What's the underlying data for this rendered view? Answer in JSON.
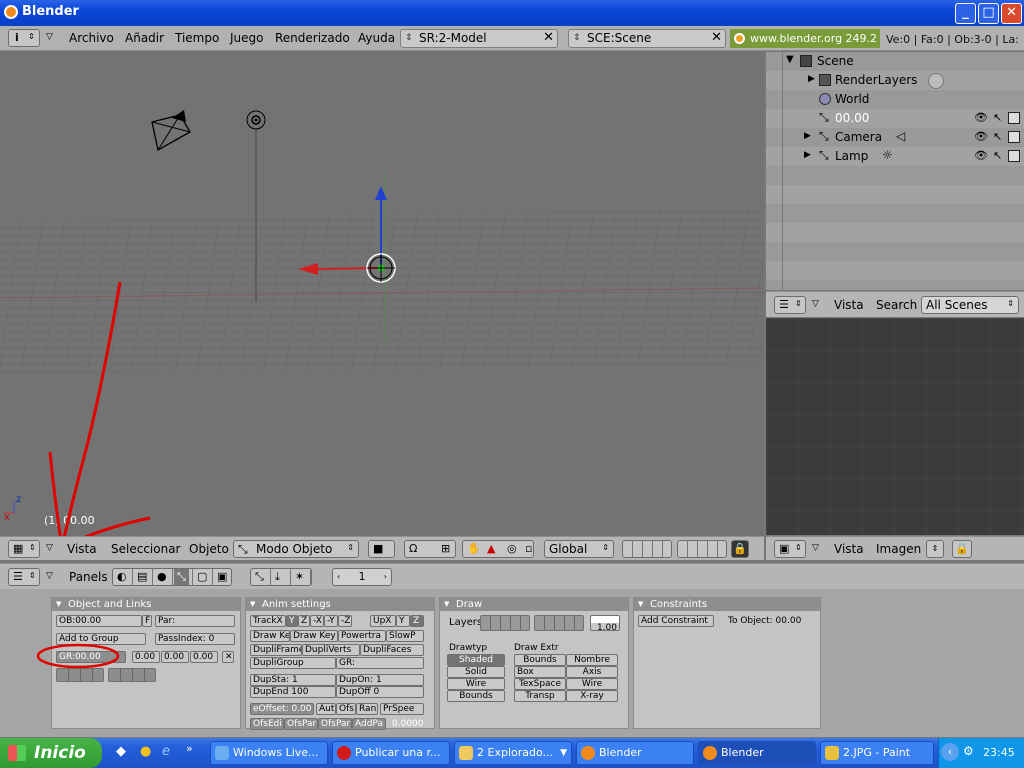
{
  "window": {
    "title": "Blender",
    "minimize": "_",
    "maximize": "□",
    "close": "✕"
  },
  "menubar": {
    "menus": [
      "Archivo",
      "Añadir",
      "Tiempo",
      "Juego",
      "Renderizado",
      "Ayuda"
    ],
    "screen": "SR:2-Model",
    "scene": "SCE:Scene",
    "url": "www.blender.org 249.2",
    "stats": "Ve:0 | Fa:0 | Ob:3-0 | La:"
  },
  "viewport": {
    "frame_label": "(1) 00.00",
    "axis_x": "x",
    "axis_z": "z"
  },
  "view3d_header": {
    "menus": [
      "Vista",
      "Seleccionar",
      "Objeto"
    ],
    "mode": "Modo Objeto",
    "orientation": "Global"
  },
  "outliner": {
    "items": [
      {
        "label": "Scene"
      },
      {
        "label": "RenderLayers"
      },
      {
        "label": "World"
      },
      {
        "label": "00.00"
      },
      {
        "label": "Camera"
      },
      {
        "label": "Lamp"
      }
    ],
    "header": {
      "menu1": "Vista",
      "menu2": "Search",
      "scenes": "All Scenes"
    }
  },
  "image_header": {
    "menu1": "Vista",
    "menu2": "Imagen"
  },
  "buttons_header": {
    "panels": "Panels",
    "frame": "1"
  },
  "panels": {
    "object_links": {
      "title": "Object and Links",
      "ob": "OB:00.00",
      "f": "F",
      "par": "Par:",
      "add_group": "Add to Group",
      "pass_index": "PassIndex: 0",
      "gr": "GR:00.00",
      "v1": "0.00",
      "v2": "0.00",
      "v3": "0.00",
      "x": "✕"
    },
    "anim": {
      "title": "Anim settings",
      "track": "TrackX",
      "y": "Y",
      "z": "Z",
      "mx": "-X",
      "my": "-Y",
      "mz": "-Z",
      "upx": "UpX",
      "upy": "Y",
      "upz": "Z",
      "drawkey": "Draw Ke",
      "drawkey2": "Draw Key",
      "powertrack": "Powertra",
      "slowpar": "SlowP",
      "dupliframes": "DupliFrame",
      "dupliverts": "DupliVerts",
      "duplifaces": "DupliFaces",
      "dupligroup": "DupliGroup",
      "gr": "GR:",
      "dupsta": "DupSta: 1",
      "dupon": "DupOn: 1",
      "dupend": "DupEnd 100",
      "dupoff": "DupOff 0",
      "offset": "eOffset: 0.00",
      "aut": "Aut",
      "ofs": "Ofs",
      "ran": "Ran",
      "prspeed": "PrSpee",
      "ofsedit": "OfsEdi",
      "ofspar": "OfsPar",
      "ofspar2": "OfsPar",
      "addpar": "AddPa",
      "zeros": "0.0000"
    },
    "draw": {
      "title": "Draw",
      "layers": "Layers",
      "scale": "1.00",
      "drawtype": "Drawtyp",
      "drawextra": "Draw Extr",
      "types": [
        "Shaded",
        "Solid",
        "Wire",
        "Bounds"
      ],
      "bounds": "Bounds",
      "nombre": "Nombre",
      "box": "Box",
      "axis": "Axis",
      "texspace": "TexSpace",
      "wire": "Wire",
      "transp": "Transp",
      "xray": "X-ray"
    },
    "constraints": {
      "title": "Constraints",
      "add": "Add Constraint",
      "to": "To Object: 00.00"
    }
  },
  "taskbar": {
    "start": "Inicio",
    "tasks": [
      "Windows Live...",
      "Publicar una r...",
      "2 Explorado...",
      "Blender",
      "Blender",
      "2.JPG - Paint"
    ],
    "clock": "23:45",
    "colors": {
      "taskbar": "#245edb",
      "start": "#3c9c3c",
      "tray": "#0f96e8"
    }
  }
}
